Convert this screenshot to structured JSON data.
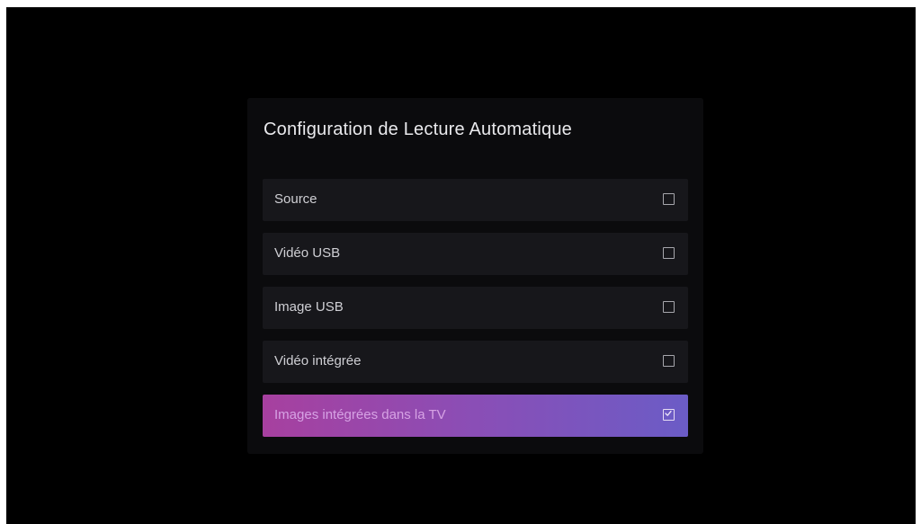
{
  "dialog": {
    "title": "Configuration de Lecture Automatique",
    "options": [
      {
        "label": "Source",
        "checked": false
      },
      {
        "label": "Vidéo USB",
        "checked": false
      },
      {
        "label": "Image USB",
        "checked": false
      },
      {
        "label": "Vidéo intégrée",
        "checked": false
      },
      {
        "label": "Images intégrées dans la TV",
        "checked": true
      }
    ]
  },
  "colors": {
    "background": "#000000",
    "dialog_background": "#0b0b0d",
    "row_background": "#17171b",
    "selected_gradient_start": "#a7409f",
    "selected_gradient_end": "#6b5cc6"
  },
  "icons": {
    "unchecked": "checkbox-empty-icon",
    "checked": "checkbox-checked-icon"
  }
}
